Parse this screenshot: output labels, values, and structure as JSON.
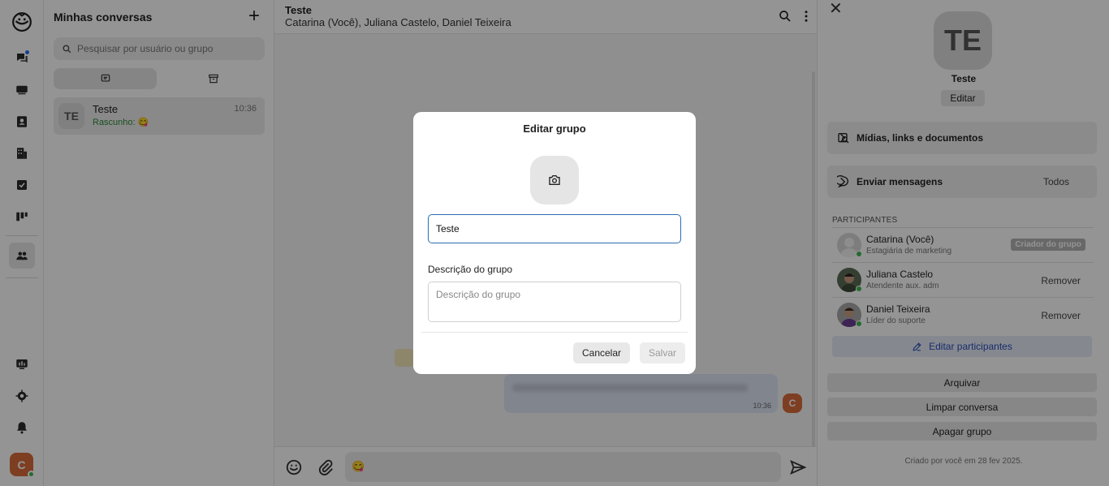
{
  "conversations": {
    "title": "Minhas conversas",
    "search_placeholder": "Pesquisar por usuário ou grupo",
    "items": [
      {
        "avatar": "TE",
        "name": "Teste",
        "draft": "Rascunho: 😋",
        "time": "10:36"
      }
    ]
  },
  "chat": {
    "title": "Teste",
    "members": "Catarina (Você), Juliana Castelo, Daniel Teixeira",
    "message_time": "10:36",
    "sender_avatar": "C",
    "composer_text": "😋"
  },
  "user": {
    "avatar": "C"
  },
  "right_panel": {
    "avatar": "TE",
    "name": "Teste",
    "edit_label": "Editar",
    "media_label": "Mídias, links e documentos",
    "send_label": "Enviar mensagens",
    "send_value": "Todos",
    "participants_header": "PARTICIPANTES",
    "participants": [
      {
        "name": "Catarina (Você)",
        "role": "Estagiária de marketing",
        "badge": "Criador do grupo"
      },
      {
        "name": "Juliana Castelo",
        "role": "Atendente aux. adm",
        "action": "Remover"
      },
      {
        "name": "Daniel Teixeira",
        "role": "Líder do suporte",
        "action": "Remover"
      }
    ],
    "edit_participants": "Editar participantes",
    "archive": "Arquivar",
    "clear": "Limpar conversa",
    "delete": "Apagar grupo",
    "footer": "Criado por você em 28 fev 2025."
  },
  "modal": {
    "title": "Editar grupo",
    "name_value": "Teste",
    "description_label": "Descrição do grupo",
    "description_placeholder": "Descrição do grupo",
    "cancel": "Cancelar",
    "save": "Salvar"
  },
  "colors": {
    "accent": "#2b6cb0",
    "online": "#3fb950",
    "user_avatar": "#d96b3c"
  },
  "icons": [
    "app-logo-icon",
    "chats-icon",
    "inbox-icon",
    "contacts-icon",
    "building-icon",
    "tasks-icon",
    "kanban-icon",
    "groups-icon",
    "dashboard-icon",
    "settings-icon",
    "bell-icon",
    "search-icon",
    "more-icon",
    "emoji-icon",
    "attach-icon",
    "send-icon",
    "camera-icon",
    "gallery-icon",
    "chat-bubble-icon",
    "chevron-right-icon",
    "pencil-icon",
    "archive-icon",
    "close-icon"
  ]
}
